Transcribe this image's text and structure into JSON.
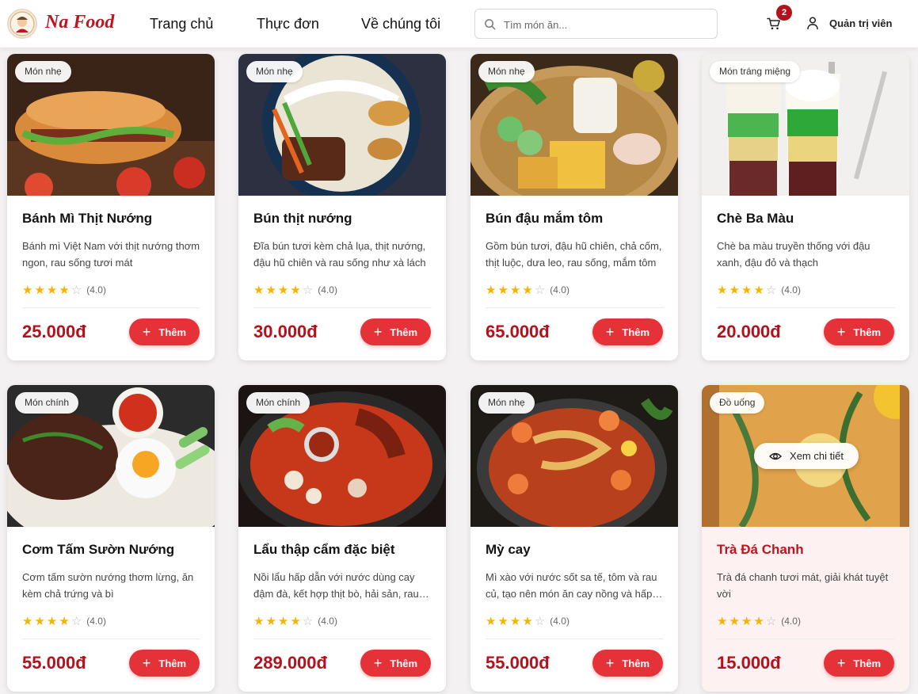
{
  "header": {
    "brand": "Na Food",
    "nav": [
      "Trang chủ",
      "Thực đơn",
      "Về chúng tôi"
    ],
    "search_placeholder": "Tìm món ăn...",
    "cart_count": "2",
    "admin_label": "Quản trị viên"
  },
  "products": [
    {
      "tag": "Món nhẹ",
      "name": "Bánh Mì Thịt Nướng",
      "desc": "Bánh mì Việt Nam với thịt nướng thơm ngon, rau sống tươi mát",
      "rating": "(4.0)",
      "price": "25.000đ",
      "add": "Thêm",
      "img": "banhmi"
    },
    {
      "tag": "Món nhẹ",
      "name": "Bún thịt nướng",
      "desc": "Đĩa bún tươi kèm chả lụa, thịt nướng, đậu hũ chiên và rau sống như xà lách",
      "rating": "(4.0)",
      "price": "30.000đ",
      "add": "Thêm",
      "img": "bun"
    },
    {
      "tag": "Món nhẹ",
      "name": "Bún đậu mắm tôm",
      "desc": "Gồm bún tươi, đậu hũ chiên, chả cốm, thịt luộc, dưa leo, rau sống, mắm tôm",
      "rating": "(4.0)",
      "price": "65.000đ",
      "add": "Thêm",
      "img": "bundau"
    },
    {
      "tag": "Món tráng miệng",
      "name": "Chè Ba Màu",
      "desc": "Chè ba màu truyền thống với đậu xanh, đậu đỏ và thạch",
      "rating": "(4.0)",
      "price": "20.000đ",
      "add": "Thêm",
      "img": "che"
    },
    {
      "tag": "Món chính",
      "name": "Cơm Tấm Sườn Nướng",
      "desc": "Cơm tấm sườn nướng thơm lừng, ăn kèm chả trứng và bì",
      "rating": "(4.0)",
      "price": "55.000đ",
      "add": "Thêm",
      "img": "comtam"
    },
    {
      "tag": "Món chính",
      "name": "Lẩu thập cẩm đặc biệt",
      "desc": "Nồi lẩu hấp dẫn với nước dùng cay đậm đà, kết hợp thịt bò, hải sản, rau nấm",
      "rating": "(4.0)",
      "price": "289.000đ",
      "add": "Thêm",
      "img": "lau"
    },
    {
      "tag": "Món nhẹ",
      "name": "Mỳ cay",
      "desc": "Mì xào với nước sốt sa tế, tôm và rau củ, tạo nên món ăn cay nồng và hấp dẫn",
      "rating": "(4.0)",
      "price": "55.000đ",
      "add": "Thêm",
      "img": "mycay"
    },
    {
      "tag": "Đồ uống",
      "name": "Trà Đá Chanh",
      "desc": "Trà đá chanh tươi mát, giải khát tuyệt vời",
      "rating": "(4.0)",
      "price": "15.000đ",
      "add": "Thêm",
      "img": "tra",
      "detail": "Xem chi tiết"
    }
  ],
  "rating_stars": 4,
  "colors": {
    "brand": "#c0141f",
    "accent": "#e53238",
    "price": "#b3121c",
    "star": "#f5b400"
  }
}
